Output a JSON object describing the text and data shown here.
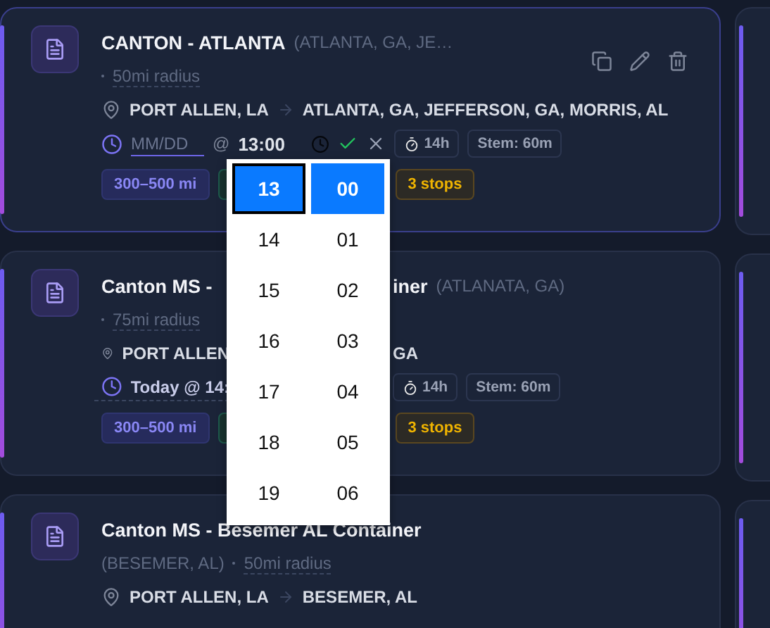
{
  "cards": [
    {
      "editing": true,
      "covered": false,
      "actions": true,
      "title": [
        "CANTON - ATLANTA"
      ],
      "subtitle": "(ATLANTA, GA, JE…",
      "kind": "inline",
      "radius": "50mi radius",
      "route": {
        "origin": [
          "PORT ALLEN, LA"
        ],
        "destination": "ATLANTA, GA, JEFFERSON, GA, MORRIS, AL"
      },
      "schedule": {
        "kind": "editor",
        "date_placeholder": "MM/DD",
        "at": "@",
        "time": "13:00"
      },
      "meta": [
        "14h",
        "Stem: 60m"
      ],
      "tags": [
        {
          "kind": "range",
          "text": "300–500 mi"
        },
        {
          "kind": "covered"
        },
        {
          "kind": "stops",
          "text": "3 stops"
        }
      ]
    },
    {
      "editing": false,
      "covered": true,
      "actions": false,
      "title": [
        "Canton MS -",
        "iner"
      ],
      "subtitle": "(ATLANATA, GA)",
      "kind": "inline",
      "radius": "75mi radius",
      "route": {
        "origin": [
          "PORT ALLEN",
          "GA"
        ]
      },
      "schedule": {
        "kind": "text",
        "text": "Today @ 14:"
      },
      "meta": [
        "14h",
        "Stem: 60m"
      ],
      "tags": [
        {
          "kind": "range",
          "text": "300–500 mi"
        },
        {
          "kind": "covered"
        },
        {
          "kind": "stops",
          "text": "3 stops"
        }
      ]
    },
    {
      "editing": false,
      "covered": false,
      "actions": false,
      "title": [
        "Canton MS - Besemer AL Container"
      ],
      "subtitle": "(BESEMER, AL)",
      "kind": "stacked",
      "radius": "50mi radius",
      "route": {
        "origin": [
          "PORT ALLEN, LA"
        ],
        "destination": "BESEMER, AL"
      }
    }
  ],
  "time_picker": {
    "hours": [
      {
        "text": "13",
        "selected": true
      },
      {
        "text": "14",
        "selected": false
      },
      {
        "text": "15",
        "selected": false
      },
      {
        "text": "16",
        "selected": false
      },
      {
        "text": "17",
        "selected": false
      },
      {
        "text": "18",
        "selected": false
      },
      {
        "text": "19",
        "selected": false
      }
    ],
    "minutes": [
      {
        "text": "00",
        "selected": true
      },
      {
        "text": "01",
        "selected": false
      },
      {
        "text": "02",
        "selected": false
      },
      {
        "text": "03",
        "selected": false
      },
      {
        "text": "04",
        "selected": false
      },
      {
        "text": "05",
        "selected": false
      },
      {
        "text": "06",
        "selected": false
      }
    ]
  }
}
